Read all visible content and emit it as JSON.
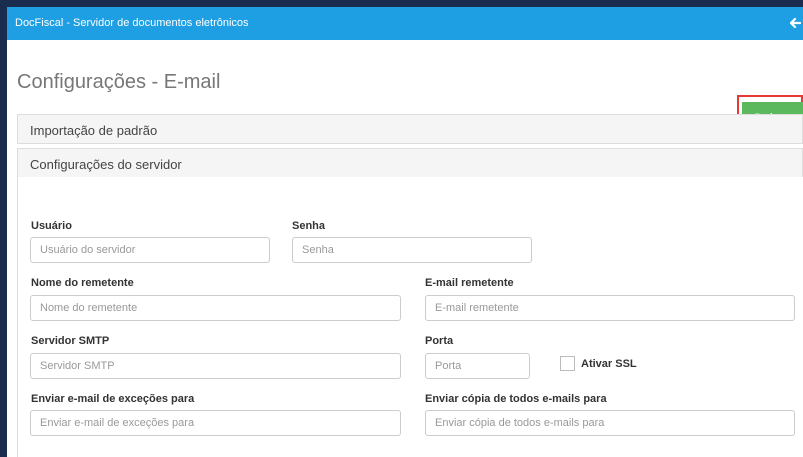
{
  "header": {
    "app_title": "DocFiscal - Servidor de documentos eletrônicos"
  },
  "page": {
    "title": "Configurações - E-mail",
    "save_label": "Salvar"
  },
  "sections": {
    "import_label": "Importação de padrão",
    "server_label": "Configurações do servidor"
  },
  "form": {
    "usuario": {
      "label": "Usuário",
      "placeholder": "Usuário do servidor"
    },
    "senha": {
      "label": "Senha",
      "placeholder": "Senha"
    },
    "nome_remetente": {
      "label": "Nome do remetente",
      "placeholder": "Nome do remetente"
    },
    "email_remetente": {
      "label": "E-mail remetente",
      "placeholder": "E-mail remetente"
    },
    "servidor_smtp": {
      "label": "Servidor SMTP",
      "placeholder": "Servidor SMTP"
    },
    "porta": {
      "label": "Porta",
      "placeholder": "Porta"
    },
    "ativar_ssl": {
      "label": "Ativar SSL",
      "checked": false
    },
    "excecoes": {
      "label": "Enviar e-mail de exceções para",
      "placeholder": "Enviar e-mail de exceções para"
    },
    "copia": {
      "label": "Enviar cópia de todos e-mails para",
      "placeholder": "Enviar cópia de todos e-mails para"
    }
  },
  "colors": {
    "topbar": "#1e9fe3",
    "frame": "#1a2d4f",
    "save_button": "#5cb85c",
    "save_highlight": "#e53935"
  },
  "icons": {
    "back": "arrow-left-icon"
  }
}
